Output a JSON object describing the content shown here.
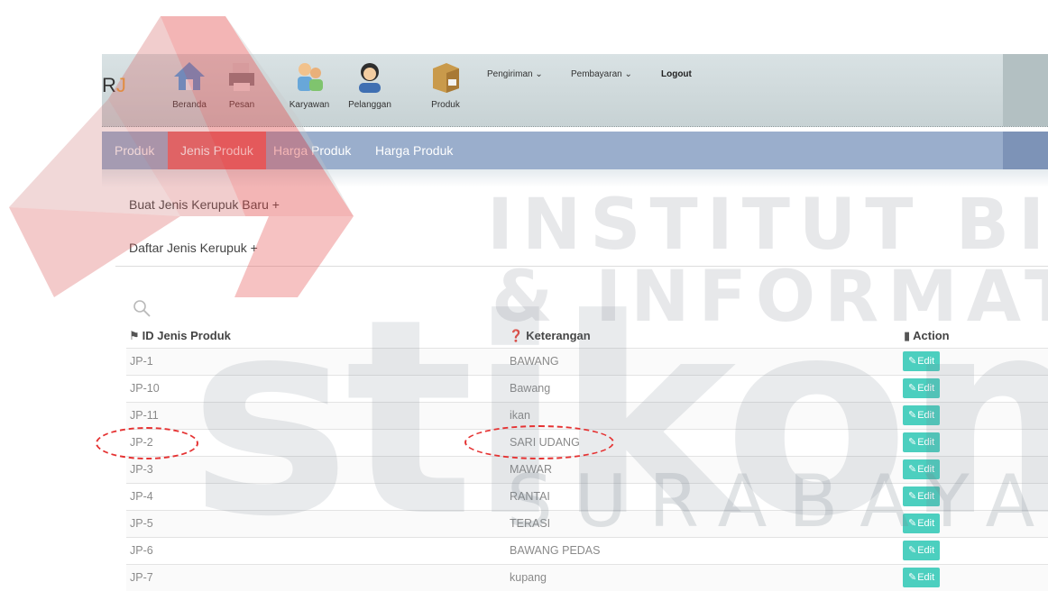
{
  "header": {
    "brand_r": "R",
    "brand_j": "J",
    "nav": [
      {
        "label": "Beranda",
        "icon": "house-icon"
      },
      {
        "label": "Pesan",
        "icon": "printer-icon"
      },
      {
        "label": "Karyawan",
        "icon": "people-icon"
      },
      {
        "label": "Pelanggan",
        "icon": "customer-icon"
      },
      {
        "label": "Produk",
        "icon": "box-icon"
      }
    ],
    "menu": {
      "pengiriman": "Pengiriman ⌄",
      "pembayaran": "Pembayaran ⌄",
      "logout": "Logout"
    }
  },
  "tabs": [
    "Produk",
    "Jenis Produk",
    "Harga Produk",
    "Harga Produk"
  ],
  "links": {
    "create": "Buat Jenis Kerupuk Baru +",
    "list": "Daftar Jenis Kerupuk +"
  },
  "table": {
    "headers": {
      "id": "ID Jenis Produk",
      "desc": "Keterangan",
      "action": "Action"
    },
    "edit_label": "Edit",
    "rows": [
      {
        "id": "JP-1",
        "desc": "BAWANG"
      },
      {
        "id": "JP-10",
        "desc": "Bawang"
      },
      {
        "id": "JP-11",
        "desc": "ikan"
      },
      {
        "id": "JP-2",
        "desc": "SARI UDANG"
      },
      {
        "id": "JP-3",
        "desc": "MAWAR"
      },
      {
        "id": "JP-4",
        "desc": "RANTAI"
      },
      {
        "id": "JP-5",
        "desc": "TERASI"
      },
      {
        "id": "JP-6",
        "desc": "BAWANG PEDAS"
      },
      {
        "id": "JP-7",
        "desc": "kupang"
      }
    ]
  },
  "watermark": {
    "line1": "INSTITUT BISNIS",
    "line2": "& INFORMATIKA",
    "big": "stikom",
    "city": "SURABAYA"
  },
  "colors": {
    "accent_tab": "#e7676a",
    "tabbar": "#9aaecc",
    "edit_button": "#4ccfbf",
    "annotation": "#e53232"
  }
}
